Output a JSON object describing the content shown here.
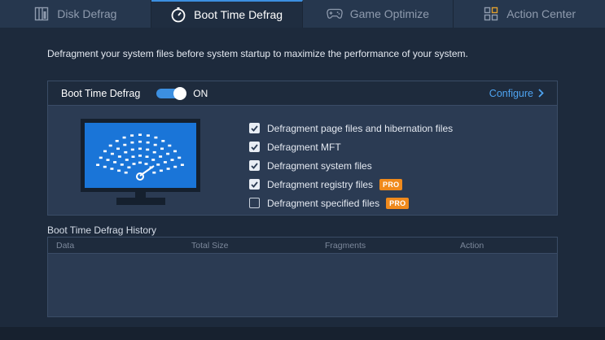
{
  "tabs": [
    {
      "label": "Disk Defrag",
      "icon": "disk-defrag-icon",
      "active": false
    },
    {
      "label": "Boot Time Defrag",
      "icon": "boot-time-icon",
      "active": true
    },
    {
      "label": "Game Optimize",
      "icon": "gamepad-icon",
      "active": false
    },
    {
      "label": "Action Center",
      "icon": "action-center-icon",
      "active": false
    }
  ],
  "description": "Defragment your system files before system startup to maximize the performance of your system.",
  "panel": {
    "title": "Boot Time Defrag",
    "toggle_state": "ON",
    "toggle_on": true,
    "configure_label": "Configure"
  },
  "options": [
    {
      "label": "Defragment page files and hibernation files",
      "checked": true,
      "pro": false
    },
    {
      "label": "Defragment MFT",
      "checked": true,
      "pro": false
    },
    {
      "label": "Defragment system files",
      "checked": true,
      "pro": false
    },
    {
      "label": "Defragment registry files",
      "checked": true,
      "pro": true
    },
    {
      "label": "Defragment specified files",
      "checked": false,
      "pro": true
    }
  ],
  "pro_badge": "PRO",
  "history": {
    "title": "Boot Time Defrag History",
    "columns": [
      "Data",
      "Total Size",
      "Fragments",
      "Action"
    ]
  },
  "colors": {
    "accent": "#3c8fe0",
    "link": "#4ea3f0",
    "pro_badge": "#f08a1c",
    "background": "#1d2a3c",
    "panel": "#2b3b53"
  }
}
